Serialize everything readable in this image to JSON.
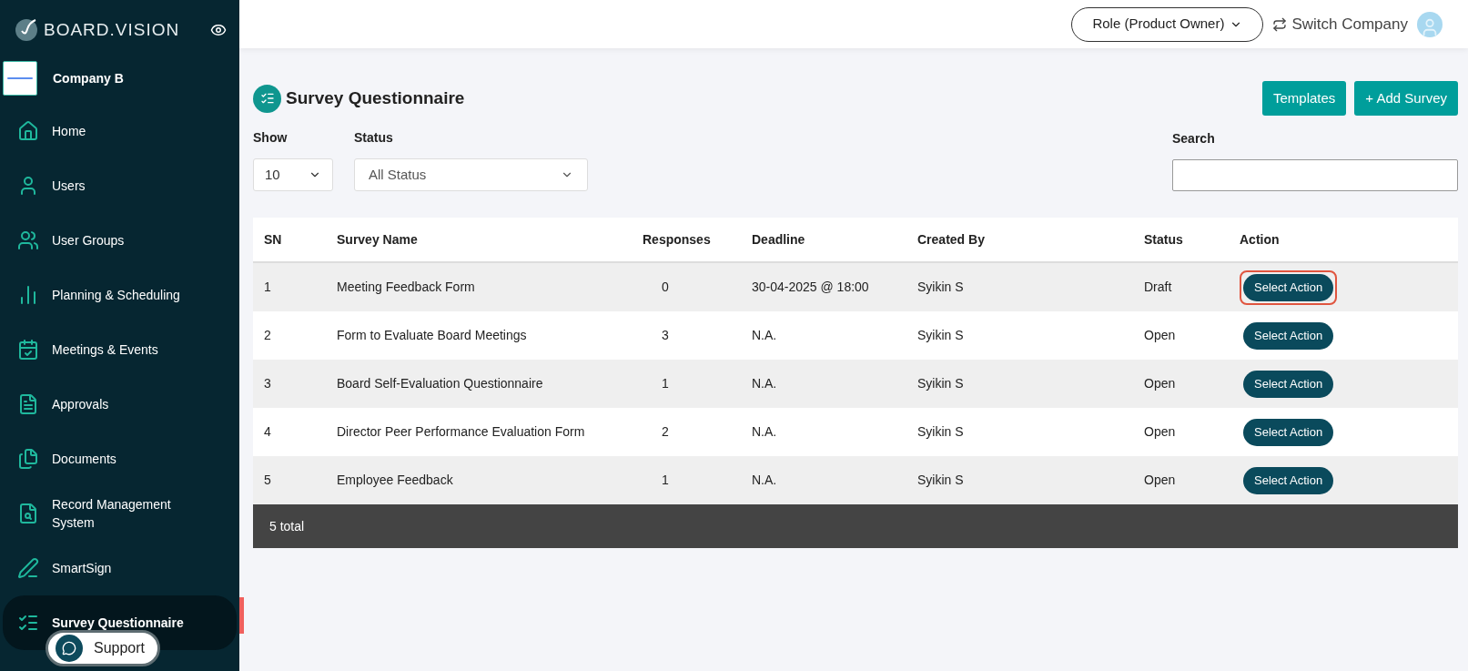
{
  "brand": {
    "name": "BOARD.VISION"
  },
  "company": {
    "name": "Company B"
  },
  "sidebar": {
    "items": [
      {
        "label": "Home",
        "selected": false
      },
      {
        "label": "Users",
        "selected": false
      },
      {
        "label": "User Groups",
        "selected": false
      },
      {
        "label": "Planning & Scheduling",
        "selected": false
      },
      {
        "label": "Meetings & Events",
        "selected": false
      },
      {
        "label": "Approvals",
        "selected": false
      },
      {
        "label": "Documents",
        "selected": false
      },
      {
        "label": "Record Management System",
        "selected": false
      },
      {
        "label": "SmartSign",
        "selected": false
      },
      {
        "label": "Survey Questionnaire",
        "selected": true
      }
    ]
  },
  "support": {
    "label": "Support"
  },
  "header": {
    "role": "Role (Product Owner)",
    "switch": "Switch Company"
  },
  "page": {
    "title": "Survey Questionnaire",
    "buttons": [
      "Templates",
      "+ Add Survey"
    ]
  },
  "filters": {
    "show_label": "Show",
    "show_value": "10",
    "status_label": "Status",
    "status_value": "All Status",
    "search_label": "Search"
  },
  "table": {
    "columns": [
      "SN",
      "Survey Name",
      "Responses",
      "Deadline",
      "Created By",
      "Status",
      "Action"
    ],
    "rows": [
      {
        "sn": "1",
        "name": "Meeting Feedback Form",
        "responses": "0",
        "deadline": "30-04-2025 @ 18:00",
        "created_by": "Syikin S",
        "status": "Draft",
        "action": "Select Action",
        "highlighted": true
      },
      {
        "sn": "2",
        "name": "Form to Evaluate Board Meetings",
        "responses": "3",
        "deadline": "N.A.",
        "created_by": "Syikin S",
        "status": "Open",
        "action": "Select Action",
        "highlighted": false
      },
      {
        "sn": "3",
        "name": "Board Self-Evaluation Questionnaire",
        "responses": "1",
        "deadline": "N.A.",
        "created_by": "Syikin S",
        "status": "Open",
        "action": "Select Action",
        "highlighted": false
      },
      {
        "sn": "4",
        "name": "Director Peer Performance Evaluation Form",
        "responses": "2",
        "deadline": "N.A.",
        "created_by": "Syikin S",
        "status": "Open",
        "action": "Select Action",
        "highlighted": false
      },
      {
        "sn": "5",
        "name": "Employee Feedback",
        "responses": "1",
        "deadline": "N.A.",
        "created_by": "Syikin S",
        "status": "Open",
        "action": "Select Action",
        "highlighted": false
      }
    ],
    "footer": "5 total"
  }
}
